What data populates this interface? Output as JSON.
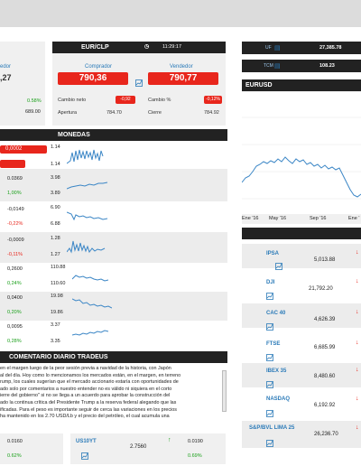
{
  "eurclp": {
    "pair": "EUR/CLP",
    "time": "11:29:17",
    "buyer_label": "Comprador",
    "seller_label": "Vendedor",
    "buy": "790,36",
    "sell": "790,77",
    "net_change_label": "Cambio neto",
    "pct_change_label": "Cambio %",
    "net_change": "-0,92",
    "pct_change": "-0,12%",
    "open_label": "Apertura",
    "open": "784.70",
    "close_label": "Cierre",
    "close": "784.92"
  },
  "left_partial": {
    "seller_label": "edor",
    "value": ",27",
    "pct": "0.58%",
    "close": "689.00"
  },
  "top_right": [
    {
      "label": "UF",
      "value": "27,385.78"
    },
    {
      "label": "TCM",
      "value": "108.23"
    }
  ],
  "eurusd": {
    "title": "EURUSD",
    "x_labels": [
      "Ene '16",
      "May '16",
      "Sep '16",
      "Ene '"
    ]
  },
  "monedas": {
    "title": "MONEDAS",
    "rows": [
      {
        "change": "0,0002",
        "pct": "",
        "hi": "1.14",
        "lo": "1.14",
        "change_color": "white",
        "highlight": true
      },
      {
        "change": "0.0369",
        "pct": "1,00%",
        "hi": "3.98",
        "lo": "3.89",
        "change_color": "black",
        "pct_color": "green"
      },
      {
        "change": "-0,0149",
        "pct": "-0,22%",
        "hi": "6.90",
        "lo": "6.88",
        "change_color": "black",
        "pct_color": "red"
      },
      {
        "change": "-0,0009",
        "pct": "-0,11%",
        "hi": "1.28",
        "lo": "1.27",
        "change_color": "black",
        "pct_color": "red"
      },
      {
        "change": "0,2600",
        "pct": "0,24%",
        "hi": "110.88",
        "lo": "110.60",
        "change_color": "black",
        "pct_color": "green"
      },
      {
        "change": "0,0400",
        "pct": "0,20%",
        "hi": "19.98",
        "lo": "19.86",
        "change_color": "black",
        "pct_color": "green"
      },
      {
        "change": "0,0095",
        "pct": "0,28%",
        "hi": "3.37",
        "lo": "3.35",
        "change_color": "black",
        "pct_color": "green"
      }
    ]
  },
  "comentario": {
    "title": "COMENTARIO DIARIO TRADEUS",
    "lines": [
      "en el margen luego de la peor sesión previa a navidad de la historia, con Japón",
      "al del día. Hoy como lo mencionamos los mercados están, en el margen, en terreno",
      "rump, los cuales sugerían que el mercado accionario estaría con oportunidades de",
      "ado solo por comentarios a nuestro entender no es válido ni siquiera en el corto",
      "ierre del gobierno\" si no se llega a un acuerdo para aprobar la construcción del",
      "ado la continua crítica del Presidente Trump a la reserva federal alegando que las",
      "ificadas. Para el peso es importante seguir de cerca las variaciones en los precios",
      "ha mantenido en los 2.70 USD/Lb y el precio del petróleo, el cual acumula una"
    ]
  },
  "bottom": {
    "left_value": "0.0160",
    "left_pct": "0.62%",
    "bond_name": "US10YT",
    "bond_value": "2.7560",
    "bond_change": "0.0190",
    "bond_pct": "0.69%"
  },
  "indices": [
    {
      "name": "IPSA",
      "value": "5,013.88"
    },
    {
      "name": "DJI",
      "value": "21,792.20"
    },
    {
      "name": "CAC 40",
      "value": "4,626.39"
    },
    {
      "name": "FTSE",
      "value": "6,685.99"
    },
    {
      "name": "IBEX 35",
      "value": "8,480.60"
    },
    {
      "name": "NASDAQ",
      "value": "6,192.92"
    },
    {
      "name": "S&P/BVL LIMA 25",
      "value": "26,236.70"
    }
  ],
  "colors": {
    "accent_red": "#e8261c",
    "link_blue": "#2a7ab8",
    "up_green": "#1aa01a",
    "header_dark": "#222222"
  }
}
